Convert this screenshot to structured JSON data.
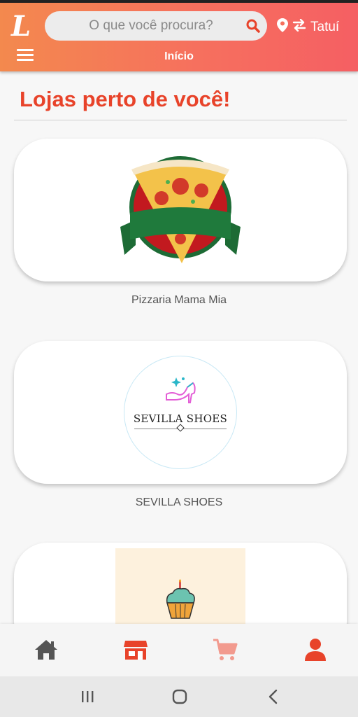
{
  "header": {
    "logo_letter": "L",
    "search_placeholder": "O que você procura?",
    "city": "Tatuí",
    "page_title": "Início"
  },
  "main": {
    "section_title": "Lojas perto de você!",
    "stores": [
      {
        "name": "Pizzaria Mama Mia"
      },
      {
        "name": "SEVILLA SHOES",
        "logo_text": "SEVILLA SHOES"
      },
      {
        "name": ""
      }
    ]
  },
  "bottom_nav": {
    "items": [
      {
        "icon": "home-icon",
        "color": "#555555"
      },
      {
        "icon": "store-icon",
        "color": "#e8432a"
      },
      {
        "icon": "cart-icon",
        "color": "#f29a8e"
      },
      {
        "icon": "user-icon",
        "color": "#e8432a"
      }
    ]
  },
  "colors": {
    "accent": "#e8432a",
    "gradient_start": "#f3894e",
    "gradient_end": "#f55f63"
  }
}
